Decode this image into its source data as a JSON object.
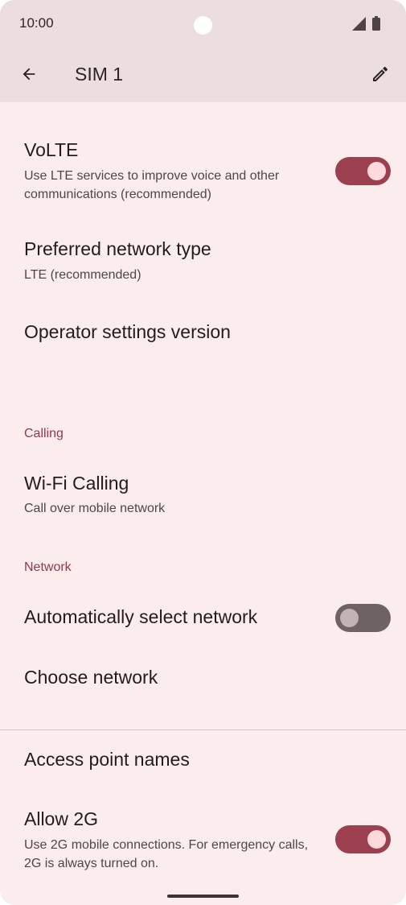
{
  "status_bar": {
    "time": "10:00"
  },
  "app_bar": {
    "title": "SIM 1"
  },
  "items": {
    "volte": {
      "title": "VoLTE",
      "summary": "Use LTE services to improve voice and other communications (recommended)",
      "enabled": true
    },
    "preferred_network": {
      "title": "Preferred network type",
      "summary": "LTE (recommended)"
    },
    "operator_settings": {
      "title": "Operator settings version"
    },
    "calling_header": "Calling",
    "wifi_calling": {
      "title": "Wi-Fi Calling",
      "summary": "Call over mobile network"
    },
    "network_header": "Network",
    "auto_select": {
      "title": "Automatically select network",
      "enabled": false
    },
    "choose_network": {
      "title": "Choose network"
    },
    "apn": {
      "title": "Access point names"
    },
    "allow_2g": {
      "title": "Allow 2G",
      "summary": "Use 2G mobile connections. For emergency calls, 2G is always turned on.",
      "enabled": true
    }
  },
  "colors": {
    "accent": "#9c4050",
    "category": "#8d3b4b",
    "background": "#fbeded",
    "header": "#ecdede"
  },
  "icons": {
    "back": "arrow-back-icon",
    "edit": "pencil-icon",
    "signal": "signal-icon",
    "battery": "battery-icon"
  }
}
